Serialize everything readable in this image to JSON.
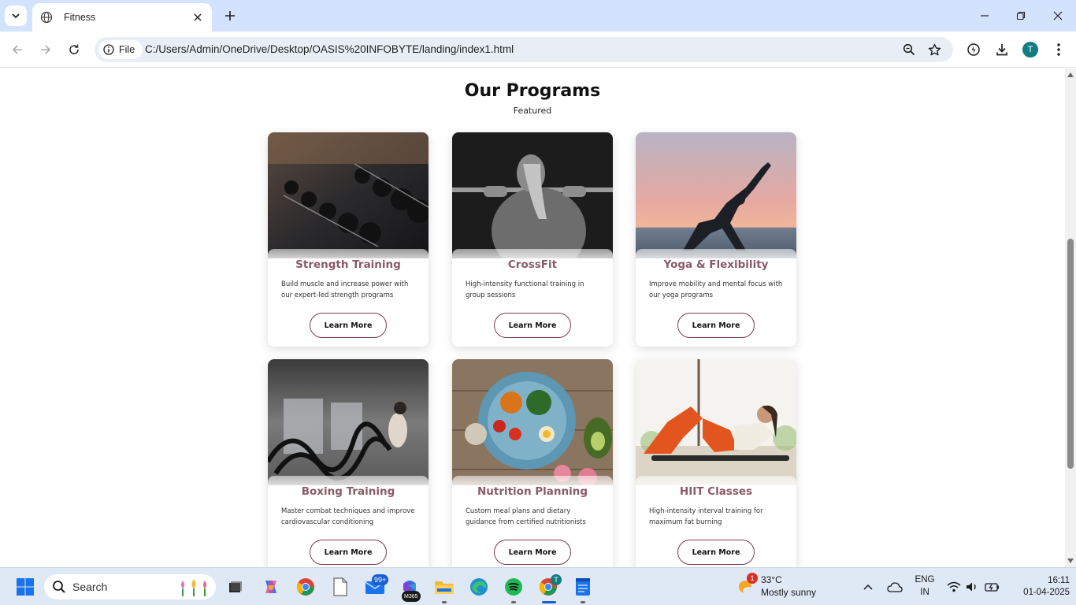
{
  "browser": {
    "tab_title": "Fitness",
    "security_chip": "File",
    "url": "C:/Users/Admin/OneDrive/Desktop/OASIS%20INFOBYTE/landing/index1.html",
    "profile_initial": "T"
  },
  "page": {
    "section_title": "Our Programs",
    "section_subtitle": "Featured",
    "cards": [
      {
        "title": "Strength Training",
        "desc": "Build muscle and increase power with our expert-led strength programs",
        "button": "Learn More"
      },
      {
        "title": "CrossFit",
        "desc": "High-intensity functional training in group sessions",
        "button": "Learn More"
      },
      {
        "title": "Yoga & Flexibility",
        "desc": "Improve mobility and mental focus with our yoga programs",
        "button": "Learn More"
      },
      {
        "title": "Boxing Training",
        "desc": "Master combat techniques and improve cardiovascular conditioning",
        "button": "Learn More"
      },
      {
        "title": "Nutrition Planning",
        "desc": "Custom meal plans and dietary guidance from certified nutritionists",
        "button": "Learn More"
      },
      {
        "title": "HIIT Classes",
        "desc": "High-intensity interval training for maximum fat burning",
        "button": "Learn More"
      }
    ],
    "colors": {
      "card_title": "#8a5a68",
      "button_border": "#7b3a4c"
    }
  },
  "taskbar": {
    "search_label": "Search",
    "mail_badge": "99+",
    "m365_badge_label": "M365",
    "weather_badge": "1",
    "weather_temp": "33°C",
    "weather_condition": "Mostly sunny",
    "lang_top": "ENG",
    "lang_bottom": "IN",
    "time": "16:11",
    "date": "01-04-2025"
  }
}
